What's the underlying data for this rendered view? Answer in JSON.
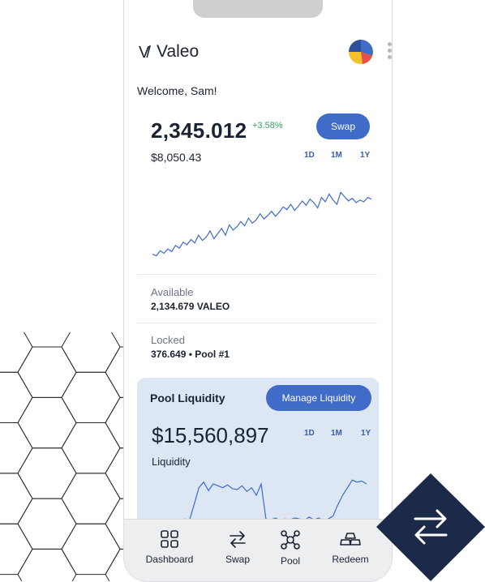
{
  "app": {
    "name": "Valeo"
  },
  "welcome": "Welcome, Sam!",
  "balance": {
    "amount": "2,345.012",
    "change": "+3.58%",
    "fiat": "$8,050.43"
  },
  "swap_button": "Swap",
  "ranges": [
    "1D",
    "1M",
    "1Y"
  ],
  "balance_chart": {
    "points": [
      8,
      6,
      12,
      9,
      14,
      11,
      18,
      15,
      22,
      19,
      25,
      21,
      30,
      24,
      28,
      35,
      26,
      32,
      38,
      30,
      42,
      36,
      40,
      46,
      41,
      50,
      44,
      48,
      55,
      49,
      53,
      58,
      52,
      57,
      63,
      60,
      66,
      59,
      64,
      70,
      65,
      72,
      68,
      62,
      74,
      69,
      78,
      71,
      66,
      80,
      75,
      70,
      73,
      68,
      71,
      69,
      74,
      72
    ],
    "color": "#3f6bc9"
  },
  "available": {
    "label": "Available",
    "value": "2,134.679 VALEO"
  },
  "locked": {
    "label": "Locked",
    "value": "376.649  •  Pool #1"
  },
  "pool": {
    "title": "Pool Liquidity",
    "manage_button": "Manage Liquidity",
    "amount": "$15,560,897",
    "subtitle": "Liquidity",
    "ranges": [
      "1D",
      "1M",
      "1Y"
    ],
    "chart_points": [
      2,
      3,
      2,
      4,
      3,
      2,
      5,
      3,
      20,
      38,
      44,
      35,
      42,
      40,
      38,
      41,
      37,
      36,
      40,
      34,
      38,
      30,
      42,
      5,
      4,
      6,
      3,
      5,
      4,
      6,
      5,
      3,
      7,
      4,
      6,
      3,
      5,
      8,
      20,
      30,
      38,
      46,
      44,
      45,
      42
    ],
    "chart_color": "#3f6bc9"
  },
  "tabs": [
    {
      "label": "Dashboard",
      "icon": "grid-icon"
    },
    {
      "label": "Swap",
      "icon": "swap-arrows-icon"
    },
    {
      "label": "Pool",
      "icon": "pool-nodes-icon"
    },
    {
      "label": "Redeem",
      "icon": "gold-bars-icon"
    }
  ],
  "colors": {
    "accent": "#3f6bc9",
    "positive": "#2fa05a",
    "card": "#dde7f4",
    "navy": "#1c2a49"
  }
}
